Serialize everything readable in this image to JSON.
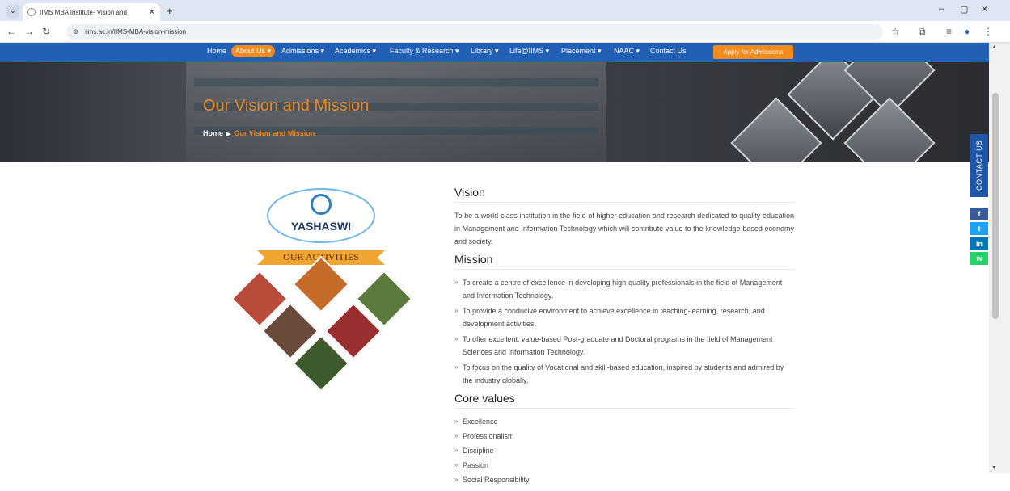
{
  "browser": {
    "tab_title": "IIMS MBA Institute- Vision and",
    "tab_close": "✕",
    "new_tab": "+",
    "url": "iims.ac.in/IIMS-MBA-vision-mission",
    "window_controls": [
      "–",
      "▢",
      "✕"
    ]
  },
  "nav": {
    "items": [
      "Home",
      "About Us ▾",
      "Admissions ▾",
      "Academics ▾",
      "Faculty & Research ▾",
      "Library ▾",
      "Life@IIMS ▾",
      "Placement ▾",
      "NAAC ▾",
      "Contact Us"
    ],
    "active_index": 1,
    "apply": "Apply for Admissions"
  },
  "banner": {
    "title": "Our Vision and Mission",
    "crumb_home": "Home",
    "crumb_sep": "▶",
    "crumb_current": "Our Vision and Mission"
  },
  "side": {
    "contact": "CONTACT US",
    "social": [
      "f",
      "t",
      "in",
      "w"
    ]
  },
  "promo": {
    "logo_text": "YASHASWI",
    "ribbon": "OUR ACTIVITIES"
  },
  "vision": {
    "heading": "Vision",
    "text": "To be a world-class institution in the field of higher education and research dedicated to quality education in Management and Information Technology which will contribute value to the knowledge-based economy and society."
  },
  "mission": {
    "heading": "Mission",
    "items": [
      "To create a centre of excellence in developing high-quality professionals in the field of Management and Information Technology.",
      "To provide a conducive environment to achieve excellence in teaching-learning, research, and development activities.",
      "To offer excellent, value-based Post-graduate and Doctoral programs in the field of Management Sciences and Information Technology.",
      "To focus on the quality of Vocational and skill-based education, inspired by students and admired by the industry globally."
    ]
  },
  "core": {
    "heading": "Core values",
    "items": [
      "Excellence",
      "Professionalism",
      "Discipline",
      "Passion",
      "Social Responsibility"
    ]
  },
  "colors": {
    "nav_blue": "#2260b6",
    "accent_orange": "#f28a1c",
    "contact_blue": "#1f56a8",
    "facebook": "#3b5998",
    "twitter": "#1da1f2",
    "linkedin": "#0077b5",
    "whatsapp": "#25d366"
  }
}
